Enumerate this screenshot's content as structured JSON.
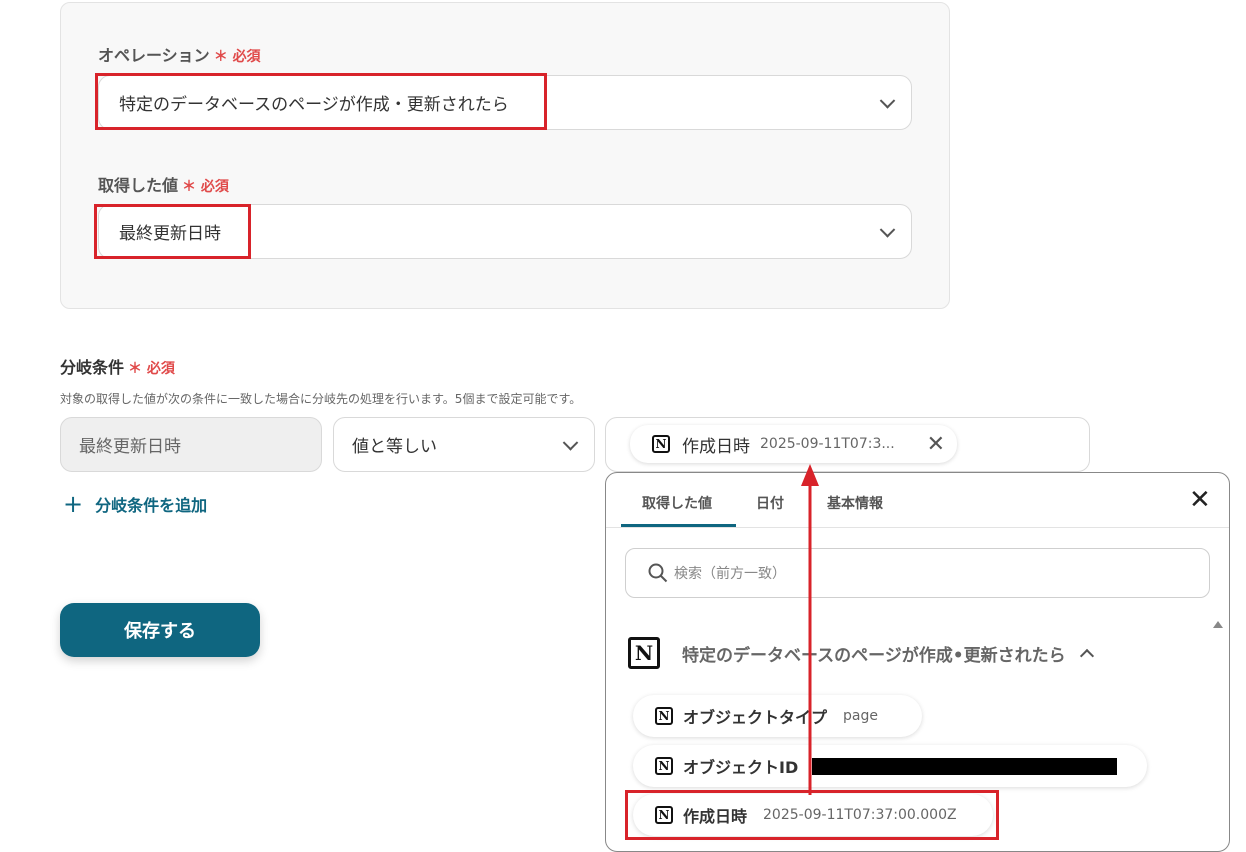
{
  "operation": {
    "label": "オペレーション",
    "required": "必須",
    "value": "特定のデータベースのページが作成・更新されたら"
  },
  "acquired": {
    "label": "取得した値",
    "required": "必須",
    "value": "最終更新日時"
  },
  "branch": {
    "label": "分岐条件",
    "required": "必須",
    "description": "対象の取得した値が次の条件に一致した場合に分岐先の処理を行います。5個まで設定可能です。",
    "field_value": "最終更新日時",
    "operator": "値と等しい",
    "chip_name": "作成日時",
    "chip_value": "2025-09-11T07:3...",
    "add_label": "分岐条件を追加"
  },
  "save_label": "保存する",
  "panel": {
    "tabs": [
      "取得した値",
      "日付",
      "基本情報"
    ],
    "search_placeholder": "検索（前方一致）",
    "group_title": "特定のデータベースのページが作成•更新されたら",
    "items": [
      {
        "name": "オブジェクトタイプ",
        "value": "page"
      },
      {
        "name": "オブジェクトID",
        "value": ""
      },
      {
        "name": "作成日時",
        "value": "2025-09-11T07:37:00.000Z"
      }
    ]
  },
  "accent_color": "#0f6680",
  "highlight_color": "#d8232a"
}
